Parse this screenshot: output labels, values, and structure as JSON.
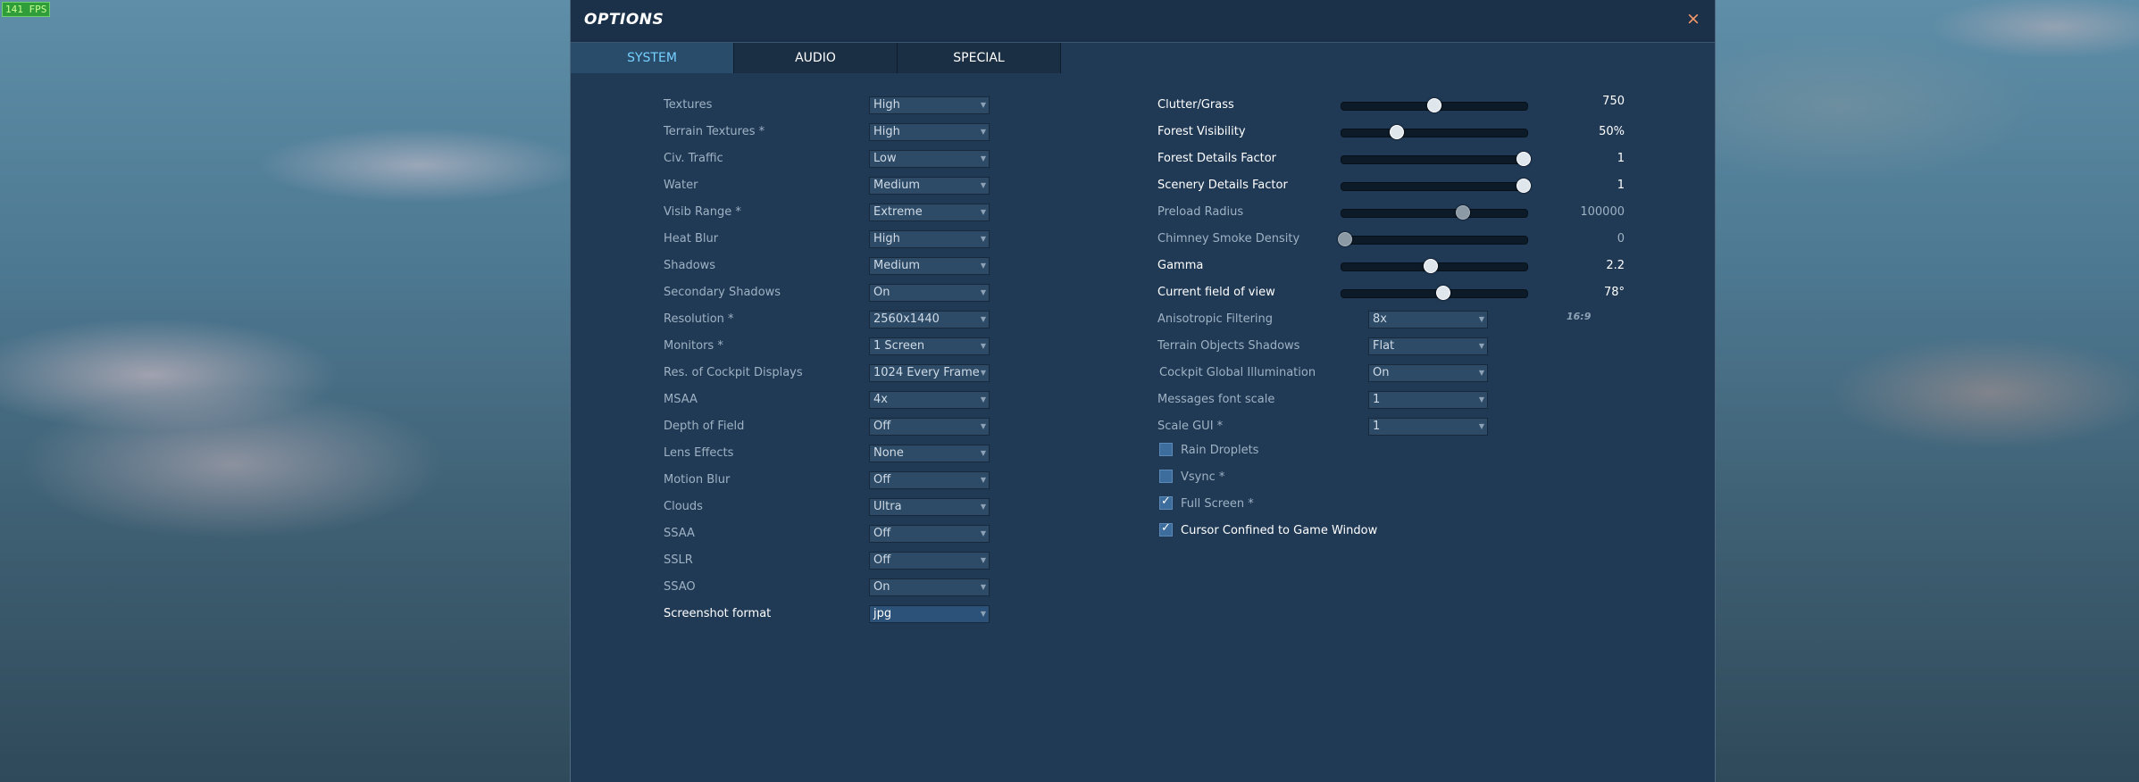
{
  "fps": "141 FPS",
  "dialog": {
    "title": "OPTIONS",
    "close": "×",
    "tabs": [
      "SYSTEM",
      "AUDIO",
      "SPECIAL"
    ]
  },
  "left_settings": [
    {
      "label": "Textures",
      "value": "High"
    },
    {
      "label": "Terrain Textures *",
      "value": "High"
    },
    {
      "label": "Civ. Traffic",
      "value": "Low"
    },
    {
      "label": "Water",
      "value": "Medium"
    },
    {
      "label": "Visib Range *",
      "value": "Extreme"
    },
    {
      "label": "Heat Blur",
      "value": "High"
    },
    {
      "label": "Shadows",
      "value": "Medium"
    },
    {
      "label": "Secondary Shadows",
      "value": "On"
    },
    {
      "label": "Resolution *",
      "value": "2560x1440"
    },
    {
      "label": "Monitors *",
      "value": "1 Screen"
    },
    {
      "label": "Res. of Cockpit Displays",
      "value": "1024 Every Frame"
    },
    {
      "label": "MSAA",
      "value": "4x"
    },
    {
      "label": "Depth of Field",
      "value": "Off"
    },
    {
      "label": "Lens Effects",
      "value": "None"
    },
    {
      "label": "Motion Blur",
      "value": "Off"
    },
    {
      "label": "Clouds",
      "value": "Ultra"
    },
    {
      "label": "SSAA",
      "value": "Off"
    },
    {
      "label": "SSLR",
      "value": "Off"
    },
    {
      "label": "SSAO",
      "value": "On"
    },
    {
      "label": "Screenshot format",
      "value": "jpg"
    }
  ],
  "aspect_ratio": "16:9",
  "sliders": [
    {
      "label": "Clutter/Grass",
      "value": "750",
      "level": 0.5
    },
    {
      "label": "Forest Visibility",
      "value": "50%",
      "level": 0.29
    },
    {
      "label": "Forest Details Factor",
      "value": "1",
      "level": 1.0
    },
    {
      "label": "Scenery Details Factor",
      "value": "1",
      "level": 1.0
    },
    {
      "label": "Preload Radius",
      "value": "100000",
      "level": 0.66
    },
    {
      "label": "Chimney Smoke Density",
      "value": "0",
      "level": 0.0
    },
    {
      "label": "Gamma",
      "value": "2.2",
      "level": 0.48
    },
    {
      "label": "Current field of view",
      "value": "78°",
      "level": 0.55
    }
  ],
  "right_dropdowns": [
    {
      "label": "Anisotropic Filtering",
      "value": "8x"
    },
    {
      "label": "Terrain Objects Shadows",
      "value": "Flat"
    },
    {
      "label": "Cockpit Global Illumination",
      "value": "On"
    },
    {
      "label": "Messages font scale",
      "value": "1"
    },
    {
      "label": "Scale GUI *",
      "value": "1"
    }
  ],
  "checkboxes": [
    {
      "label": "Rain Droplets",
      "checked": false
    },
    {
      "label": "Vsync *",
      "checked": false
    },
    {
      "label": "Full Screen *",
      "checked": true
    },
    {
      "label": "Cursor Confined to Game Window",
      "checked": true
    }
  ]
}
